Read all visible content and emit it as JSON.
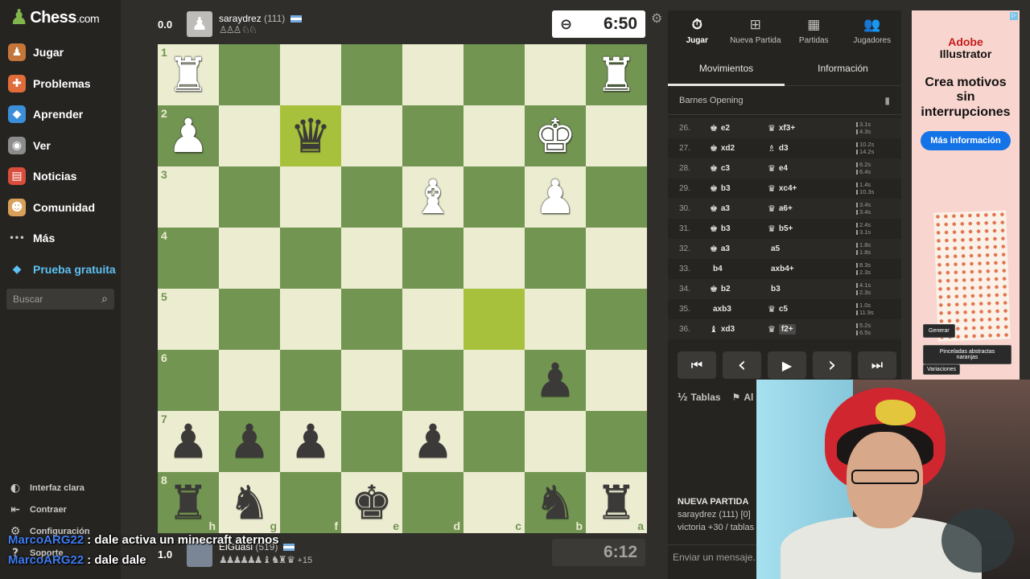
{
  "brand": {
    "logo_text": "Chess",
    "logo_suffix": ".com"
  },
  "nav": [
    {
      "label": "Jugar",
      "icon": "play-icon",
      "glyph": "♟",
      "color": "#c4763a"
    },
    {
      "label": "Problemas",
      "icon": "puzzle-icon",
      "glyph": "✚",
      "color": "#e06c3a"
    },
    {
      "label": "Aprender",
      "icon": "learn-icon",
      "glyph": "◆",
      "color": "#3c8ed8"
    },
    {
      "label": "Ver",
      "icon": "watch-icon",
      "glyph": "◉",
      "color": "#8c8c8c"
    },
    {
      "label": "Noticias",
      "icon": "news-icon",
      "glyph": "▤",
      "color": "#d94d3c"
    },
    {
      "label": "Comunidad",
      "icon": "community-icon",
      "glyph": "☻",
      "color": "#d9a05a"
    },
    {
      "label": "Más",
      "icon": "more-icon",
      "glyph": "•••",
      "color": "transparent"
    },
    {
      "label": "Prueba gratuita",
      "icon": "diamond-icon",
      "glyph": "◆",
      "color": "transparent"
    }
  ],
  "search": {
    "placeholder": "Buscar"
  },
  "bottom_links": [
    {
      "label": "Interfaz clara",
      "glyph": "◐"
    },
    {
      "label": "Contraer",
      "glyph": "⇤"
    },
    {
      "label": "Configuración",
      "glyph": "⚙"
    },
    {
      "label": "Soporte",
      "glyph": "?"
    }
  ],
  "chat": [
    {
      "user": "MarcoARG22",
      "text": ": dale activa un minecraft aternos"
    },
    {
      "user": "MarcoARG22",
      "text": ": dale dale"
    }
  ],
  "top_player": {
    "score": "0.0",
    "name": "saraydrez",
    "rating": "(111)",
    "captured": "♙♙♙ ♘♘",
    "clock": "6:50"
  },
  "bottom_player": {
    "score": "1.0",
    "name": "ElGuasi",
    "rating": "(519)",
    "captured": "♟♟♟♟♟♟ ♝ ♞♜ ♛",
    "advantage": "+15",
    "clock": "6:12"
  },
  "board": {
    "ranks": [
      "1",
      "2",
      "3",
      "4",
      "5",
      "6",
      "7",
      "8"
    ],
    "files": [
      "h",
      "g",
      "f",
      "e",
      "d",
      "c",
      "b",
      "a"
    ],
    "squares": [
      [
        "wR",
        "",
        "",
        "",
        "",
        "",
        "",
        "wR"
      ],
      [
        "wP",
        "",
        "bQ",
        "",
        "",
        "",
        "wK",
        ""
      ],
      [
        "",
        "",
        "",
        "",
        "wB",
        "",
        "wP",
        ""
      ],
      [
        "",
        "",
        "",
        "",
        "",
        "",
        "",
        ""
      ],
      [
        "",
        "",
        "",
        "",
        "",
        "",
        "",
        ""
      ],
      [
        "",
        "",
        "",
        "",
        "",
        "",
        "bP",
        ""
      ],
      [
        "bP",
        "bP",
        "bP",
        "",
        "bP",
        "",
        "",
        ""
      ],
      [
        "bR",
        "bN",
        "",
        "bK",
        "",
        "",
        "bN",
        "bR"
      ]
    ],
    "highlights": [
      [
        1,
        2
      ],
      [
        4,
        5
      ]
    ]
  },
  "right_panel": {
    "tabs": [
      {
        "label": "Jugar",
        "glyph": "⏱"
      },
      {
        "label": "Nueva Partida",
        "glyph": "⊞"
      },
      {
        "label": "Partidas",
        "glyph": "▦"
      },
      {
        "label": "Jugadores",
        "glyph": "👥"
      }
    ],
    "subtabs": [
      "Movimientos",
      "Información"
    ],
    "opening": "Barnes Opening",
    "moves": [
      {
        "n": "26.",
        "wi": "♚",
        "w": "e2",
        "bi": "♛",
        "b": "xf3+",
        "t1": "3.1s",
        "t2": "4.3s"
      },
      {
        "n": "27.",
        "wi": "♚",
        "w": "xd2",
        "bi": "♗",
        "b": "d3",
        "t1": "10.2s",
        "t2": "14.2s"
      },
      {
        "n": "28.",
        "wi": "♚",
        "w": "c3",
        "bi": "♛",
        "b": "e4",
        "t1": "6.2s",
        "t2": "6.4s"
      },
      {
        "n": "29.",
        "wi": "♚",
        "w": "b3",
        "bi": "♛",
        "b": "xc4+",
        "t1": "1.4s",
        "t2": "10.3s"
      },
      {
        "n": "30.",
        "wi": "♚",
        "w": "a3",
        "bi": "♛",
        "b": "a6+",
        "t1": "3.4s",
        "t2": "3.4s"
      },
      {
        "n": "31.",
        "wi": "♚",
        "w": "b3",
        "bi": "♛",
        "b": "b5+",
        "t1": "2.4s",
        "t2": "3.1s"
      },
      {
        "n": "32.",
        "wi": "♚",
        "w": "a3",
        "bi": "",
        "b": "a5",
        "t1": "1.8s",
        "t2": "1.8s"
      },
      {
        "n": "33.",
        "wi": "",
        "w": "b4",
        "bi": "",
        "b": "axb4+",
        "t1": "8.3s",
        "t2": "2.3s"
      },
      {
        "n": "34.",
        "wi": "♚",
        "w": "b2",
        "bi": "",
        "b": "b3",
        "t1": "4.1s",
        "t2": "2.3s"
      },
      {
        "n": "35.",
        "wi": "",
        "w": "axb3",
        "bi": "♛",
        "b": "c5",
        "t1": "1.0s",
        "t2": "11.9s"
      },
      {
        "n": "36.",
        "wi": "♝",
        "w": "xd3",
        "bi": "♛",
        "b": "f2+",
        "t1": "5.2s",
        "t2": "6.5s"
      }
    ],
    "controls": [
      {
        "name": "first-move-button",
        "glyph": "⏮"
      },
      {
        "name": "prev-move-button",
        "glyph": "‹"
      },
      {
        "name": "play-button",
        "glyph": "▶"
      },
      {
        "name": "next-move-button",
        "glyph": "›"
      },
      {
        "name": "last-move-button",
        "glyph": "⏭"
      }
    ],
    "draw_label": "Tablas",
    "abandon_label": "Al",
    "new_game_title": "NUEVA PARTIDA",
    "new_game_line1": "saraydrez (111) [0]",
    "new_game_line2": "victoria +30 / tablas",
    "message_placeholder": "Enviar un mensaje..."
  },
  "ad": {
    "brand_line1": "Adobe",
    "brand_line2": "Illustrator",
    "headline": "Crea motivos sin interrupciones",
    "cta": "Más información",
    "chip1": "Generar",
    "chip2": "Pinceladas abstractas naranjas",
    "chip3": "Variaciones"
  },
  "colors": {
    "light_square": "#ebecd0",
    "dark_square": "#739552",
    "highlight": "#b9ca43",
    "accent": "#81b64c"
  }
}
